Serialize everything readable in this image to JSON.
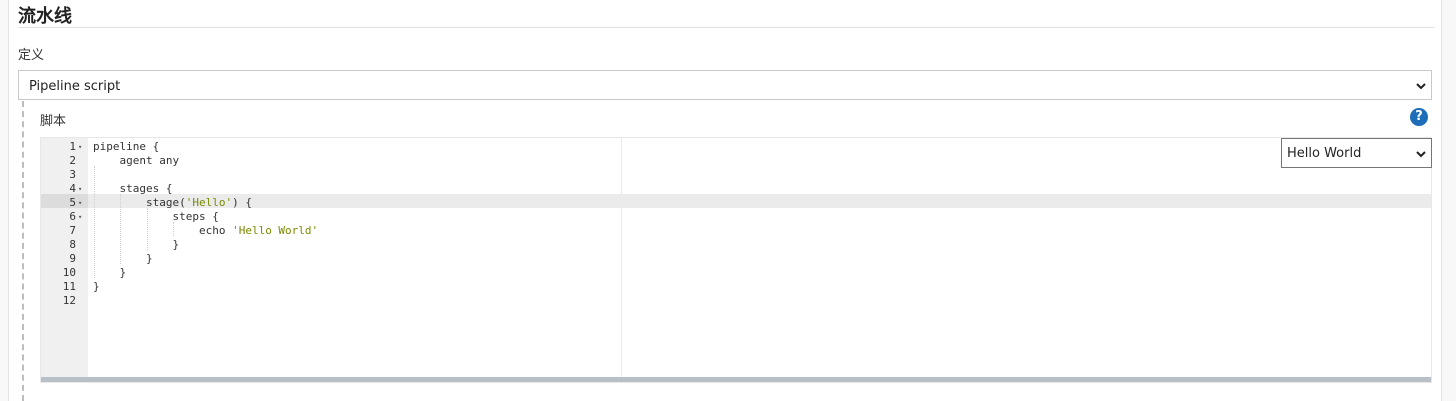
{
  "section": {
    "title": "流水线"
  },
  "definition": {
    "label": "定义",
    "selected": "Pipeline script"
  },
  "script": {
    "label": "脚本",
    "help": "?",
    "sample_selected": "Hello World",
    "lines": [
      {
        "num": "1",
        "code": "pipeline {",
        "fold": true
      },
      {
        "num": "2",
        "code": "    agent any",
        "fold": false
      },
      {
        "num": "3",
        "code": "",
        "fold": false
      },
      {
        "num": "4",
        "code": "    stages {",
        "fold": true
      },
      {
        "num": "5",
        "code_pre": "        stage(",
        "code_str": "'Hello'",
        "code_post": ") {",
        "fold": true
      },
      {
        "num": "6",
        "code": "            steps {",
        "fold": true
      },
      {
        "num": "7",
        "code_pre": "                echo ",
        "code_str": "'Hello World'",
        "code_post": "",
        "fold": false
      },
      {
        "num": "8",
        "code": "            }",
        "fold": false
      },
      {
        "num": "9",
        "code": "        }",
        "fold": false
      },
      {
        "num": "10",
        "code": "    }",
        "fold": false
      },
      {
        "num": "11",
        "code": "}",
        "fold": false
      },
      {
        "num": "12",
        "code": "",
        "fold": false
      }
    ]
  },
  "colors": {
    "help_icon": "#1e6db8",
    "string": "#7a8a00",
    "active_line": "#ebebeb"
  },
  "icons": {
    "help": "help-circle-icon",
    "dropdown": "chevron-down-icon",
    "fold": "fold-arrow-icon"
  }
}
